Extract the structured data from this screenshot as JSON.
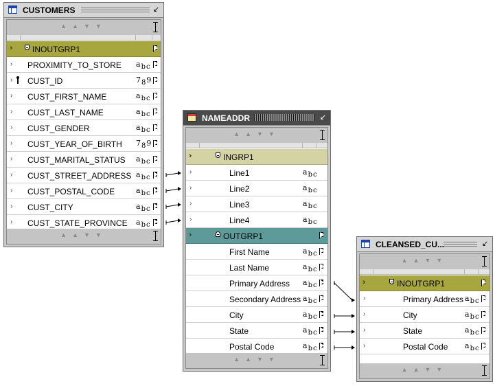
{
  "customers": {
    "title": "CUSTOMERS",
    "group": "INOUTGRP1",
    "attributes": [
      {
        "name": "PROXIMITY_TO_STORE",
        "type": "abc",
        "linked": false,
        "key": false
      },
      {
        "name": "CUST_ID",
        "type": "789",
        "linked": false,
        "key": true
      },
      {
        "name": "CUST_FIRST_NAME",
        "type": "abc",
        "linked": false,
        "key": false
      },
      {
        "name": "CUST_LAST_NAME",
        "type": "abc",
        "linked": false,
        "key": false
      },
      {
        "name": "CUST_GENDER",
        "type": "abc",
        "linked": false,
        "key": false
      },
      {
        "name": "CUST_YEAR_OF_BIRTH",
        "type": "789",
        "linked": false,
        "key": false
      },
      {
        "name": "CUST_MARITAL_STATUS",
        "type": "abc",
        "linked": false,
        "key": false
      },
      {
        "name": "CUST_STREET_ADDRESS",
        "type": "abc",
        "linked": true,
        "key": false
      },
      {
        "name": "CUST_POSTAL_CODE",
        "type": "abc",
        "linked": true,
        "key": false
      },
      {
        "name": "CUST_CITY",
        "type": "abc",
        "linked": true,
        "key": false
      },
      {
        "name": "CUST_STATE_PROVINCE",
        "type": "abc",
        "linked": true,
        "key": false
      }
    ]
  },
  "nameaddr": {
    "title": "NAMEADDR",
    "in_group": "INGRP1",
    "in_attributes": [
      {
        "name": "Line1",
        "type": "abc"
      },
      {
        "name": "Line2",
        "type": "abc"
      },
      {
        "name": "Line3",
        "type": "abc"
      },
      {
        "name": "Line4",
        "type": "abc"
      }
    ],
    "out_group": "OUTGRP1",
    "out_attributes": [
      {
        "name": "First Name",
        "type": "abc",
        "linked": false
      },
      {
        "name": "Last Name",
        "type": "abc",
        "linked": false
      },
      {
        "name": "Primary Address",
        "type": "abc",
        "linked": true
      },
      {
        "name": "Secondary Address",
        "type": "abc",
        "linked": false
      },
      {
        "name": "City",
        "type": "abc",
        "linked": true
      },
      {
        "name": "State",
        "type": "abc",
        "linked": true
      },
      {
        "name": "Postal Code",
        "type": "abc",
        "linked": true
      }
    ]
  },
  "cleansed": {
    "title": "CLEANSED_CU...",
    "group": "INOUTGRP1",
    "attributes": [
      {
        "name": "Primary Address",
        "type": "abc"
      },
      {
        "name": "City",
        "type": "abc"
      },
      {
        "name": "State",
        "type": "abc"
      },
      {
        "name": "Postal Code",
        "type": "abc"
      }
    ]
  },
  "links": [
    {
      "from": "CUSTOMERS.CUST_STREET_ADDRESS",
      "to": "NAMEADDR.Line1"
    },
    {
      "from": "CUSTOMERS.CUST_POSTAL_CODE",
      "to": "NAMEADDR.Line2"
    },
    {
      "from": "CUSTOMERS.CUST_CITY",
      "to": "NAMEADDR.Line3"
    },
    {
      "from": "CUSTOMERS.CUST_STATE_PROVINCE",
      "to": "NAMEADDR.Line4"
    },
    {
      "from": "NAMEADDR.Primary Address",
      "to": "CLEANSED_CU....Primary Address"
    },
    {
      "from": "NAMEADDR.City",
      "to": "CLEANSED_CU....City"
    },
    {
      "from": "NAMEADDR.State",
      "to": "CLEANSED_CU....State"
    },
    {
      "from": "NAMEADDR.Postal Code",
      "to": "CLEANSED_CU....Postal Code"
    }
  ],
  "icons": {
    "table": "table-icon",
    "transform": "name-address-icon",
    "minimize": "minimize-icon",
    "expand": "expand-arrow-icon",
    "group": "group-icon",
    "port": "port-icon",
    "key": "key-icon"
  }
}
